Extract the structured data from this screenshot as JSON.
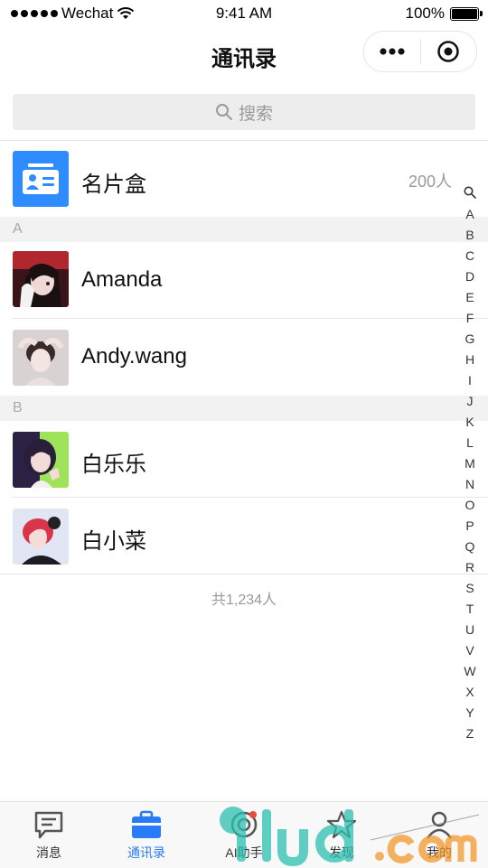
{
  "status_bar": {
    "carrier": "Wechat",
    "time": "9:41 AM",
    "battery": "100%",
    "battery_level": 1.0
  },
  "navbar": {
    "title": "通讯录",
    "more_icon": "more-dots-icon",
    "close_icon": "target-circle-icon"
  },
  "search": {
    "placeholder": "搜索",
    "icon": "search-icon"
  },
  "card_box": {
    "label": "名片盒",
    "count": "200人",
    "icon": "contact-card-icon",
    "color": "#2f8cff"
  },
  "sections": [
    {
      "letter": "A",
      "contacts": [
        {
          "name": "Amanda"
        },
        {
          "name": "Andy.wang"
        }
      ]
    },
    {
      "letter": "B",
      "contacts": [
        {
          "name": "白乐乐"
        },
        {
          "name": "白小菜"
        }
      ]
    }
  ],
  "footer_count": "共1,234人",
  "alpha_index": [
    "A",
    "B",
    "C",
    "D",
    "E",
    "F",
    "G",
    "H",
    "I",
    "J",
    "K",
    "L",
    "M",
    "N",
    "O",
    "P",
    "Q",
    "R",
    "S",
    "T",
    "U",
    "V",
    "W",
    "X",
    "Y",
    "Z"
  ],
  "tabs": [
    {
      "label": "消息",
      "icon": "message-icon",
      "active": false
    },
    {
      "label": "通讯录",
      "icon": "briefcase-icon",
      "active": true
    },
    {
      "label": "AI助手",
      "icon": "ai-assistant-icon",
      "active": false
    },
    {
      "label": "发现",
      "icon": "discover-icon",
      "active": false
    },
    {
      "label": "我的",
      "icon": "profile-icon",
      "active": false
    }
  ],
  "colors": {
    "accent": "#2a7cf6",
    "section_bg": "#f2f2f2"
  }
}
